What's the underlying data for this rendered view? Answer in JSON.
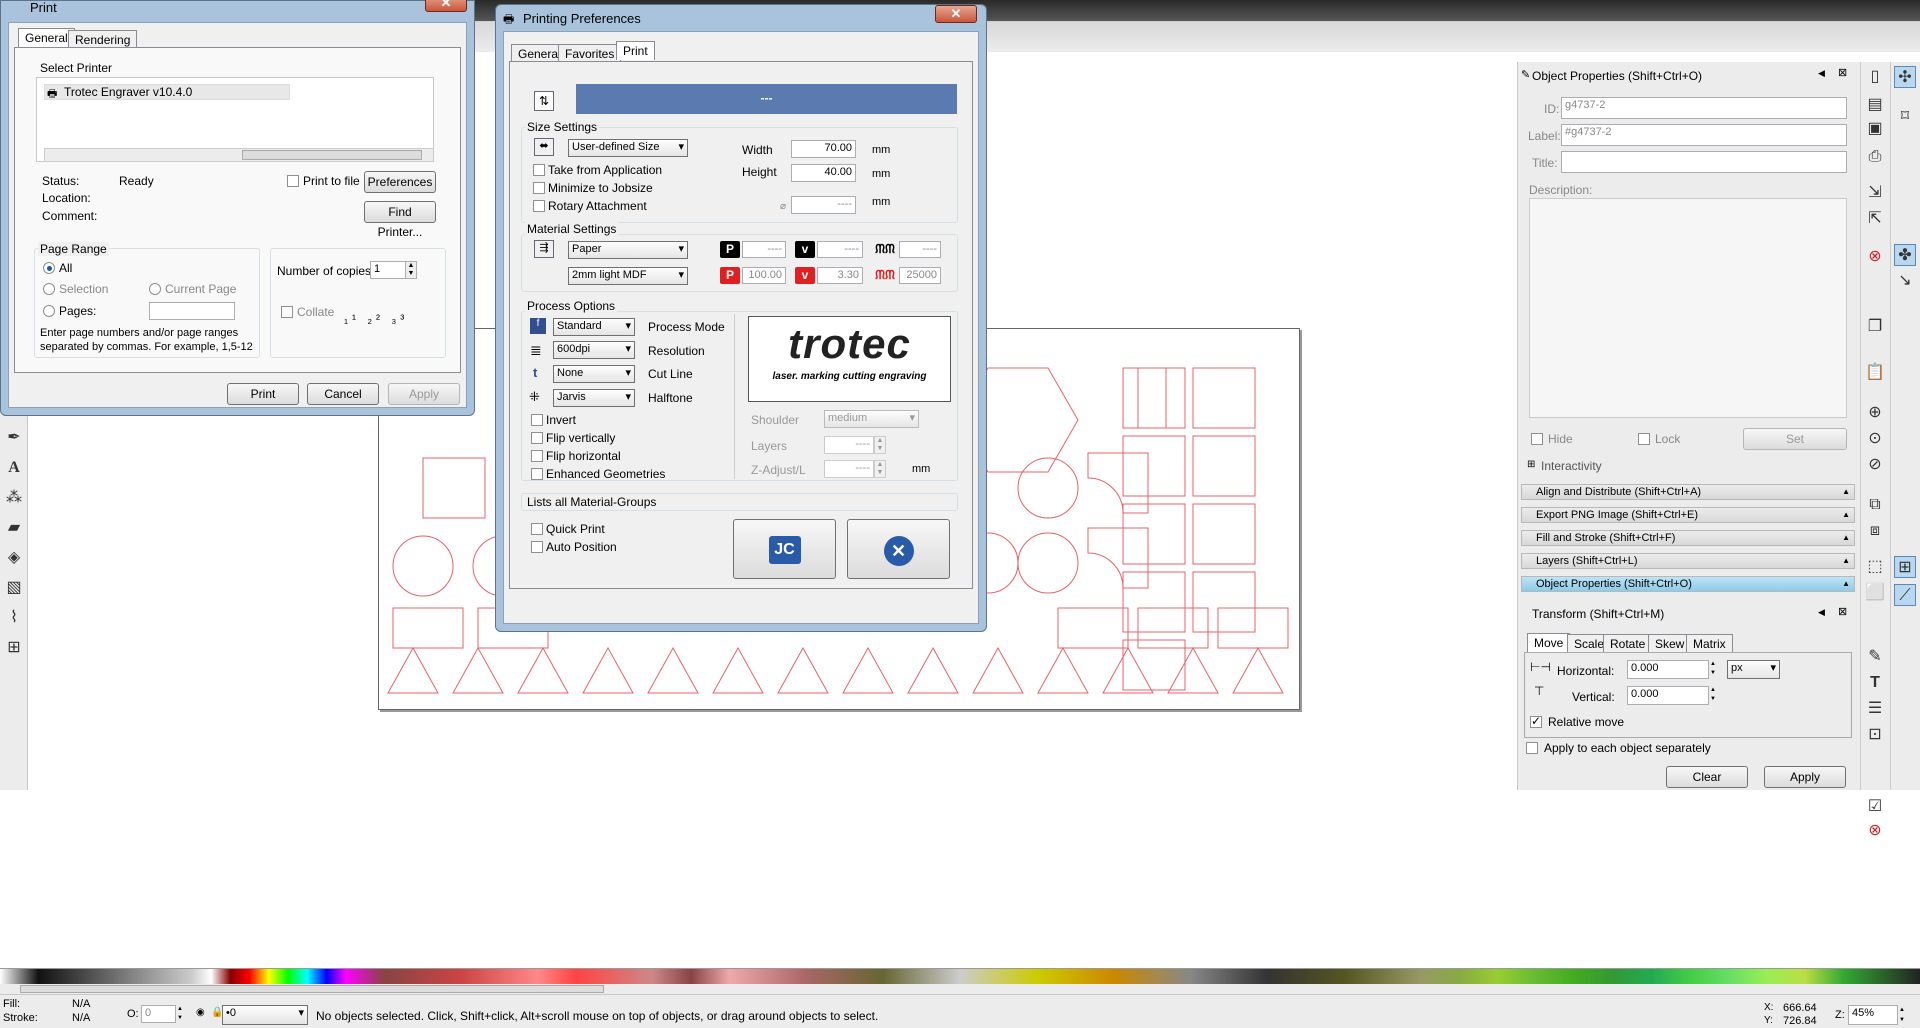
{
  "colors": {
    "accent": "#5b7bb0",
    "chrome": "#a9c3dc",
    "cut_red": "#e8606a",
    "close": "#c9563c"
  },
  "print_dialog": {
    "title": "Print",
    "tabs": [
      "General",
      "Rendering"
    ],
    "select_printer_label": "Select Printer",
    "printer_name": "Trotec Engraver v10.4.0",
    "status_label": "Status:",
    "status_value": "Ready",
    "location_label": "Location:",
    "comment_label": "Comment:",
    "print_to_file": "Print to file",
    "preferences_btn": "Preferences",
    "find_printer_btn": "Find Printer...",
    "page_range_label": "Page Range",
    "all": "All",
    "selection": "Selection",
    "current_page": "Current Page",
    "pages": "Pages:",
    "copies_label": "Number of copies:",
    "copies_value": "1",
    "collate": "Collate",
    "hint": "Enter page numbers and/or page ranges separated by commas.  For example, 1,5-12",
    "print_btn": "Print",
    "cancel_btn": "Cancel",
    "apply_btn": "Apply"
  },
  "prefs": {
    "title": "Printing Preferences",
    "tabs": [
      "General",
      "Favorites",
      "Print"
    ],
    "banner": "---",
    "size_settings": "Size Settings",
    "size_select": "User-defined Size",
    "take_from_app": "Take from Application",
    "minimize": "Minimize to Jobsize",
    "rotary": "Rotary Attachment",
    "width_label": "Width",
    "width_value": "70.00",
    "height_label": "Height",
    "height_value": "40.00",
    "mm": "mm",
    "diam_value": "----",
    "material_settings": "Material Settings",
    "material": "Paper",
    "material2": "2mm light MDF",
    "p_top": "----",
    "v_top": "----",
    "f_top": "----",
    "p_bot": "100.00",
    "v_bot": "3.30",
    "f_bot": "25000",
    "process_options": "Process Options",
    "process_mode_val": "Standard",
    "process_mode": "Process Mode",
    "resolution_val": "600dpi",
    "resolution": "Resolution",
    "cutline_val": "None",
    "cutline": "Cut Line",
    "halftone_val": "Jarvis",
    "halftone": "Halftone",
    "invert": "Invert",
    "flip_v": "Flip vertically",
    "flip_h": "Flip horizontal",
    "enhanced": "Enhanced Geometries",
    "logo": "trotec",
    "logo_sub": "laser. marking cutting engraving",
    "shoulder": "Shoulder",
    "shoulder_val": "medium",
    "layers": "Layers",
    "layers_val": "----",
    "zadjust": "Z-Adjust/L",
    "zadjust_val": "----",
    "lists_all": "Lists all Material-Groups",
    "quick_print": "Quick Print",
    "auto_position": "Auto Position"
  },
  "objprops": {
    "title": "Object Properties (Shift+Ctrl+O)",
    "id_label": "ID:",
    "id_value": "g4737-2",
    "label_label": "Label:",
    "label_value": "#g4737-2",
    "title_label": "Title:",
    "desc_label": "Description:",
    "hide": "Hide",
    "lock": "Lock",
    "set": "Set",
    "interactivity": "Interactivity"
  },
  "docks": [
    "Align and Distribute (Shift+Ctrl+A)",
    "Export PNG Image (Shift+Ctrl+E)",
    "Fill and Stroke (Shift+Ctrl+F)",
    "Layers (Shift+Ctrl+L)",
    "Object Properties (Shift+Ctrl+O)"
  ],
  "transform": {
    "title": "Transform (Shift+Ctrl+M)",
    "tabs": [
      "Move",
      "Scale",
      "Rotate",
      "Skew",
      "Matrix"
    ],
    "horizontal": "Horizontal:",
    "h_val": "0.000",
    "vertical": "Vertical:",
    "v_val": "0.000",
    "unit": "px",
    "relative": "Relative move",
    "apply_each": "Apply to each object separately",
    "clear": "Clear",
    "apply": "Apply"
  },
  "status": {
    "fill_label": "Fill:",
    "fill_val": "N/A",
    "stroke_label": "Stroke:",
    "stroke_val": "N/A",
    "o_label": "O:",
    "o_val": "0",
    "layer": "•0",
    "message": "No objects selected. Click, Shift+click, Alt+scroll mouse on top of objects, or drag around objects to select.",
    "x_label": "X:",
    "x_val": "666.64",
    "y_label": "Y:",
    "y_val": "726.84",
    "z_label": "Z:",
    "zoom": "45%"
  }
}
